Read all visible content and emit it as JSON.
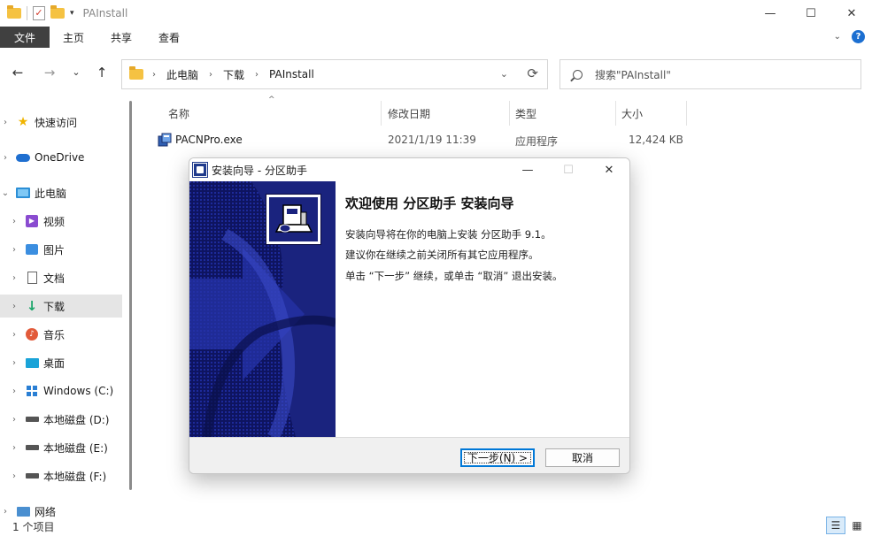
{
  "window": {
    "title": "PAInstall",
    "minimize": "—",
    "maximize": "☐",
    "close": "✕"
  },
  "ribbon": {
    "tabs": [
      "文件",
      "主页",
      "共享",
      "查看"
    ],
    "help": "?",
    "expand": "⌄"
  },
  "nav": {
    "back": "←",
    "forward": "→",
    "recent": "⌄",
    "up": "↑",
    "breadcrumb": [
      "此电脑",
      "下载",
      "PAInstall"
    ],
    "separator": "›",
    "dropdown": "⌄",
    "refresh": "⟳",
    "search_placeholder": "搜索\"PAInstall\""
  },
  "sidebar": {
    "items": [
      {
        "label": "快速访问",
        "icon": "star-icon",
        "expander": "›"
      },
      {
        "label": "OneDrive",
        "icon": "cloud-icon",
        "expander": "›"
      },
      {
        "label": "此电脑",
        "icon": "computer-icon",
        "expander": "⌄"
      },
      {
        "label": "视频",
        "icon": "video-icon",
        "expander": "›"
      },
      {
        "label": "图片",
        "icon": "picture-icon",
        "expander": "›"
      },
      {
        "label": "文档",
        "icon": "document-icon",
        "expander": "›"
      },
      {
        "label": "下载",
        "icon": "download-icon",
        "expander": "›"
      },
      {
        "label": "音乐",
        "icon": "music-icon",
        "expander": "›"
      },
      {
        "label": "桌面",
        "icon": "desktop-icon",
        "expander": "›"
      },
      {
        "label": "Windows (C:)",
        "icon": "windows-drive-icon",
        "expander": "›"
      },
      {
        "label": "本地磁盘 (D:)",
        "icon": "disk-icon",
        "expander": "›"
      },
      {
        "label": "本地磁盘 (E:)",
        "icon": "disk-icon",
        "expander": "›"
      },
      {
        "label": "本地磁盘 (F:)",
        "icon": "disk-icon",
        "expander": "›"
      },
      {
        "label": "网络",
        "icon": "network-icon",
        "expander": "›"
      }
    ],
    "selected": "下载"
  },
  "filelist": {
    "columns": [
      "名称",
      "修改日期",
      "类型",
      "大小"
    ],
    "sort_caret": "^",
    "rows": [
      {
        "name": "PACNPro.exe",
        "modified": "2021/1/19 11:39",
        "type": "应用程序",
        "size": "12,424 KB"
      }
    ]
  },
  "status": {
    "count": "1 个项目",
    "details_view": "☰",
    "icons_view": "▦"
  },
  "dialog": {
    "title": "安装向导 - 分区助手",
    "heading": "欢迎使用 分区助手 安装向导",
    "lines": [
      "安装向导将在你的电脑上安装 分区助手 9.1。",
      "建议你在继续之前关闭所有其它应用程序。",
      "单击 “下一步” 继续，或单击 “取消” 退出安装。"
    ],
    "next_button": "下一步(N) >",
    "cancel_button": "取消",
    "minimize": "—",
    "maximize": "☐",
    "close": "✕"
  },
  "colors": {
    "wizard_navy": "#1a237e",
    "wizard_dark": "#0a0a40",
    "selection": "#e5e5e5",
    "accent": "#0078d7"
  }
}
